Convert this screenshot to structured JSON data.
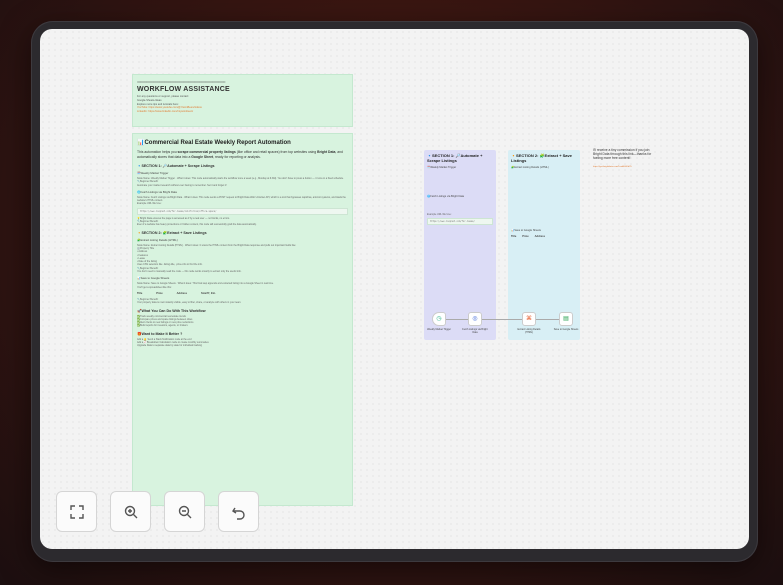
{
  "workflow_note": {
    "separator": "================================================",
    "title": "WORKFLOW ASSISTANCE",
    "lines": [
      "For any questions or support, please contact:",
      "Google-Sheets-Ideas",
      "",
      "Explore more tips and tutorials here:"
    ],
    "links": [
      "YouTube: https://www.youtube.com/@YaronBeen/videos",
      "LinkedIn: https://www.linkedin.com/in/yaronbeen/"
    ]
  },
  "main_note": {
    "title": "📊Commercial Real Estate Weekly Report Automation",
    "intro_a": "This automation helps you ",
    "intro_b": "scrape commercial property listings",
    "intro_c": " (like office and retail spaces) from top websites using ",
    "intro_d": "Bright Data",
    "intro_e": ", and automatically stores that data into a ",
    "intro_f": "Google Sheet",
    "intro_g": ", ready for reporting or analysis.",
    "sec1": "🔹SECTION 1: 🔎Automate + Scrape Listings",
    "sec1_sub1": "🗓️Weekly Market Trigger",
    "sec1_sub1_body": "Node Name: Weekly Market Trigger · What it does: This node automatically starts the workflow once a week (e.g., Monday at 9 AM). You don't have to press a button — it runs on a fixed schedule.",
    "sec1_sub1_why": "🔧Beginner Benefit:",
    "sec1_sub1_why_body": "Automate your market research without ever having to remember. Set it and forget it!",
    "sec1_sub2": "🌐Fetch Listings via Bright Data",
    "sec1_sub2_body": "Node Name: Fetch Listings via Bright Data · What it does: This node sends a POST request to Bright Data Web Unlocker API, which is a tool that bypasses captchas, anti-bot systems, and loads the website's HTML content.",
    "sec1_example": "Example URL We Use:",
    "sec1_url": "https://www.loopnet.com/for-lease/california/office-space/",
    "sec1_sub2_note": "💡Bright Data ensures the page is accessed as if by a real user — no blocks, no errors.",
    "sec1_sub2_why": "🔧Beginner Benefit:",
    "sec1_sub2_why_body": "Even if a website has heavy protections or hidden content, this node will successfully grab the data automatically.",
    "sec2": "🔸SECTION 2: 🧩Extract + Save Listings",
    "sec2_sub1": "🧩Extract Listing Details (HTML)",
    "sec2_sub1_body": "Node Name: Extract Listing Details (HTML) · What it does: It scans the HTML content from the Bright Data response and pulls out important fields like:",
    "sec2_fields": [
      "🏢Property Title",
      "• Address",
      "• Features",
      "• Lease",
      "• Date of the listing"
    ],
    "sec2_css": "Uses CSS selectors like .listing-title, .price-info to find the info.",
    "sec2_why": "🔧Beginner Benefit:",
    "sec2_why_body": "You don't need to manually read the code — this node works smartly to extract only the useful info.",
    "sec2_sub2": "📊Save to Google Sheets",
    "sec2_sub2_body": "Node Name: Save to Google Sheets · What it does: This final step appends and extracted listing into a Google Sheet in real time.",
    "sec2_sheet": "You'll get a spreadsheet like this:",
    "table_head": [
      "Title",
      "Price",
      "Address",
      "Size/ft², Etc."
    ],
    "sec2_why2": "🔧Beginner Benefit:",
    "sec2_why2_body": "Your property data is now instantly visible, easy to filter, share, or analyze with others in your team.",
    "what_can_do": "🚀What You Can Do With This Workflow",
    "what_items": [
      "✅Track weekly commercial real estate trends",
      "✅Compare prices and space listings between cities",
      "✅Alert clients to new listings or new price reductions",
      "✅Build reports for investors, agents, or brokers"
    ],
    "better": "🎁Want to Make It Better ?",
    "better_items": [
      "Add a 🔔 Send a Slack Notification node at the end",
      "Add a 📈Breakdown Calculation node to create monthly summaries",
      "Upgrade Data to separate data by state for individual tracking"
    ]
  },
  "flow_left": {
    "title": "🔹SECTION 1: 🔎Automate + Scrape Listings",
    "sub1": "🗓️Weekly Market Trigger",
    "sub2": "🌐Fetch Listings via Bright Data",
    "example": "Example URL We Use:",
    "url": "https://www.loopnet.com/for-lease/"
  },
  "flow_right": {
    "title": "🔸SECTION 2: 🧩Extract + Save Listings",
    "sub1": "🧩Extract Listing Details (HTML)",
    "sub2": "📊Save to Google Sheets",
    "table_head": [
      "Title",
      "Price",
      "Address",
      "Size/ft², Etc."
    ]
  },
  "nodes": [
    {
      "label": "Weekly Market Trigger",
      "icon": "clock-icon",
      "glyph": "◷",
      "color": "#2bb38a"
    },
    {
      "label": "Fetch Listings via Bright Data",
      "icon": "globe-icon",
      "glyph": "◎",
      "color": "#3a64d8"
    },
    {
      "label": "Extract Listing Details (HTML)",
      "icon": "code-icon",
      "glyph": "⌘",
      "color": "#e65a2a"
    },
    {
      "label": "Save to Google Sheets",
      "icon": "sheets-icon",
      "glyph": "▤",
      "color": "#1e9e4a"
    }
  ],
  "side_note": {
    "text": "I'll receive a tiny commission if you join Bright Data through this link—thanks for fueling more free content!",
    "link": "https://get.brightdata.com/1tndi4600b25"
  },
  "toolbar": {
    "buttons": [
      {
        "name": "fit-view-button",
        "icon": "fit-view-icon"
      },
      {
        "name": "zoom-in-button",
        "icon": "zoom-in-icon"
      },
      {
        "name": "zoom-out-button",
        "icon": "zoom-out-icon"
      },
      {
        "name": "undo-button",
        "icon": "undo-icon"
      }
    ]
  }
}
